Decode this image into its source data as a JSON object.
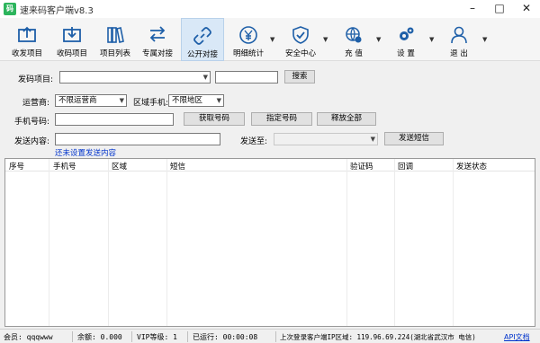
{
  "window": {
    "title": "速来码客户端v8.3",
    "icon_text": "码"
  },
  "toolbar": {
    "items": [
      {
        "label": "收发项目",
        "icon": "inbox-send-icon"
      },
      {
        "label": "收码项目",
        "icon": "inbox-download-icon"
      },
      {
        "label": "项目列表",
        "icon": "books-icon"
      },
      {
        "label": "专属对接",
        "icon": "exchange-arrows-icon"
      },
      {
        "label": "公开对接",
        "icon": "chain-link-icon"
      },
      {
        "label": "明细统计",
        "icon": "yuan-coin-icon"
      },
      {
        "label": "安全中心",
        "icon": "shield-check-icon"
      },
      {
        "label": "充  值",
        "icon": "globe-gear-icon"
      },
      {
        "label": "设  置",
        "icon": "gears-icon"
      },
      {
        "label": "退  出",
        "icon": "user-icon"
      }
    ]
  },
  "form": {
    "project_label": "发码项目:",
    "search_button": "搜索",
    "operator_label": "运营商:",
    "operator_value": "不限运营商",
    "region_label": "区域手机:",
    "region_value": "不限地区",
    "phone_label": "手机号码:",
    "get_number_button": "获取号码",
    "specify_number_button": "指定号码",
    "release_all_button": "释放全部",
    "content_label": "发送内容:",
    "send_to_label": "发送至:",
    "send_sms_button": "发送短信",
    "not_set_link": "还未设置发送内容"
  },
  "table": {
    "columns": [
      "序号",
      "手机号",
      "区域",
      "短信",
      "验证码",
      "回调",
      "发送状态"
    ],
    "rows": []
  },
  "status": {
    "member": "会员: qqqwww",
    "balance": "余额: 0.000",
    "vip": "VIP等级: 1",
    "runtime": "已运行: 00:00:08",
    "last_login": "上次登录客户端IP区域: 119.96.69.224(湖北省武汉市 电信)",
    "api_doc": "API文档"
  },
  "colors": {
    "accent": "#1e5fa8",
    "link": "#0033cc",
    "active_bg": "#d9e8f7"
  }
}
